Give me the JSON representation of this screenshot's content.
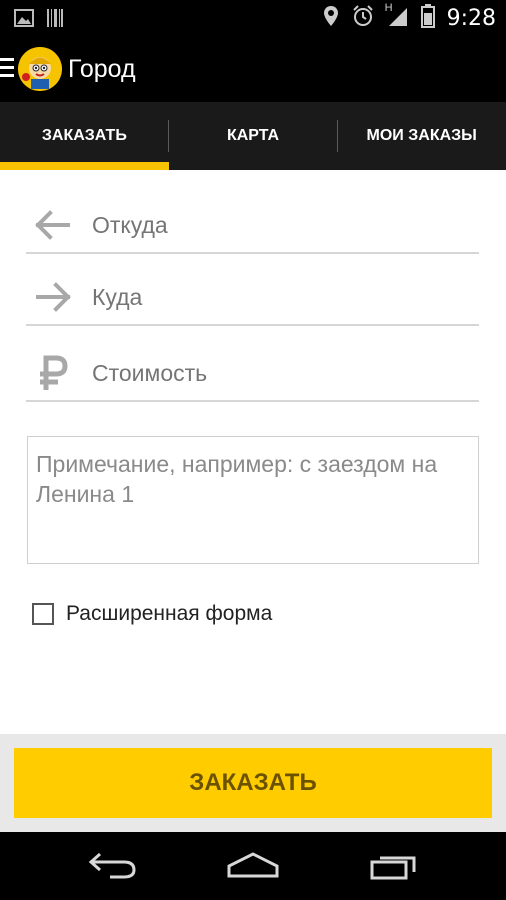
{
  "status_bar": {
    "time": "9:28",
    "left_icons": [
      "image-icon",
      "barcode-icon"
    ],
    "right_icons": [
      "location-icon",
      "alarm-icon",
      "signal-icon",
      "battery-icon"
    ],
    "network_label": "H"
  },
  "action_bar": {
    "title": "Город"
  },
  "tabs": [
    {
      "label": "ЗАКАЗАТЬ",
      "active": true
    },
    {
      "label": "КАРТА",
      "active": false
    },
    {
      "label": "МОИ ЗАКАЗЫ",
      "active": false
    }
  ],
  "form": {
    "from_placeholder": "Откуда",
    "to_placeholder": "Куда",
    "cost_placeholder": "Стоимость",
    "note_placeholder": "Примечание, например: с заездом на Ленина 1",
    "extended_form_label": "Расширенная форма",
    "extended_form_checked": false
  },
  "order_button": {
    "label": "ЗАКАЗАТЬ"
  },
  "colors": {
    "accent": "#ffcc00",
    "tab_bar": "#1a1a1a",
    "icon_gray": "#a8a8a8"
  }
}
